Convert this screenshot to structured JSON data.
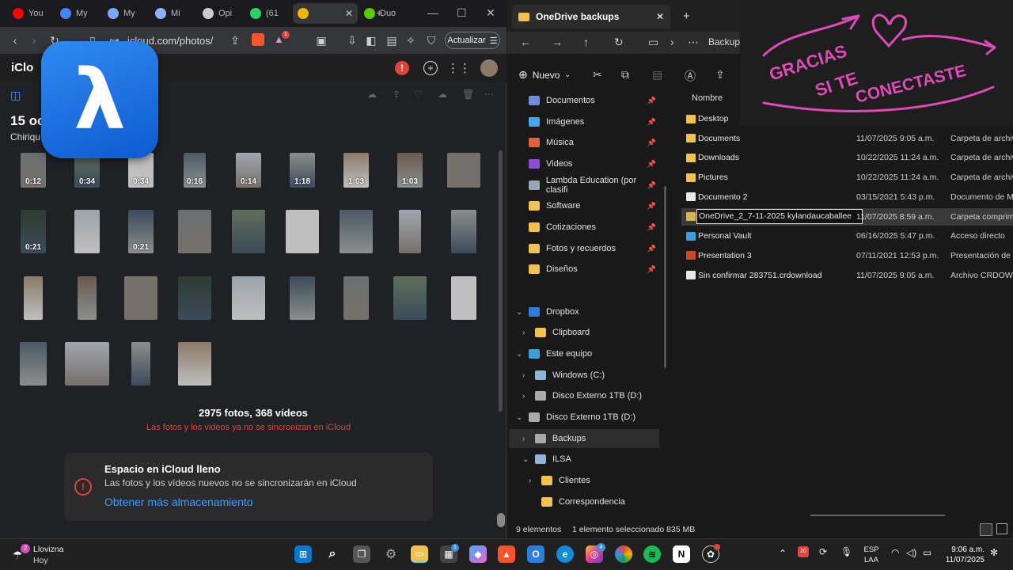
{
  "browser": {
    "tabs": [
      {
        "label": "You",
        "color": "#ff0000"
      },
      {
        "label": "My",
        "color": "#4285f4"
      },
      {
        "label": "My",
        "color": "#7aa7ff"
      },
      {
        "label": "Mi",
        "color": "#8ab4f8"
      },
      {
        "label": "Opi",
        "color": "#cccccc"
      },
      {
        "label": "(61",
        "color": "#25d366"
      },
      {
        "label": "",
        "color": "#f4b400"
      },
      {
        "label": "Duo",
        "color": "#58cc02"
      }
    ],
    "url": "icloud.com/photos/",
    "update_label": "Actualizar",
    "brave_badge": "1"
  },
  "icloud": {
    "brand": "iClo",
    "alert_badge": "!",
    "date_title": "15 oc",
    "location": "Chiriqu",
    "lambda_glyph": "λ",
    "counts": "2975 fotos, 368 vídeos",
    "sync_warning": "Las fotos y los videos ya no se sincronizan en iCloud",
    "storage_card": {
      "title": "Espacio en iCloud lleno",
      "description": "Las fotos y los vídeos nuevos no se sincronizarán en iCloud",
      "link": "Obtener más almacenamiento",
      "icon": "!"
    },
    "photos": [
      {
        "duration": "0:12"
      },
      {
        "duration": "0:34"
      },
      {
        "duration": "0:34"
      },
      {
        "duration": "0:16"
      },
      {
        "duration": "0:14"
      },
      {
        "duration": "1:18"
      },
      {
        "duration": "1:03"
      },
      {
        "duration": "1:03"
      },
      {
        "duration": ""
      },
      {
        "duration": "0:21"
      },
      {
        "duration": ""
      },
      {
        "duration": "0:21"
      },
      {
        "duration": ""
      },
      {
        "duration": ""
      },
      {
        "duration": ""
      },
      {
        "duration": ""
      },
      {
        "duration": ""
      },
      {
        "duration": ""
      },
      {
        "duration": ""
      },
      {
        "duration": ""
      },
      {
        "duration": ""
      },
      {
        "duration": ""
      },
      {
        "duration": ""
      },
      {
        "duration": ""
      },
      {
        "duration": ""
      },
      {
        "duration": ""
      },
      {
        "duration": ""
      },
      {
        "duration": ""
      },
      {
        "duration": ""
      },
      {
        "duration": ""
      },
      {
        "duration": ""
      }
    ]
  },
  "explorer": {
    "tab_title": "OneDrive backups",
    "breadcrumb": "Backups",
    "new_label": "Nuevo",
    "column_name": "Nombre",
    "sidebar": [
      {
        "label": "Documentos",
        "color": "#6e8fd8",
        "pinned": true
      },
      {
        "label": "Imágenes",
        "color": "#4aa3f0",
        "pinned": true
      },
      {
        "label": "Música",
        "color": "#e0623c",
        "pinned": true
      },
      {
        "label": "Videos",
        "color": "#8a4fd8",
        "pinned": true
      },
      {
        "label": "Lambda Education (por clasifi",
        "color": "#9aa6b8",
        "pinned": true
      },
      {
        "label": "Software",
        "color": "#f2c14e",
        "pinned": true
      },
      {
        "label": "Cotizaciones",
        "color": "#f2c14e",
        "pinned": true
      },
      {
        "label": "Fotos y recuerdos",
        "color": "#f2c14e",
        "pinned": true
      },
      {
        "label": "Diseños",
        "color": "#f2c14e",
        "pinned": true
      },
      {
        "label": "Dropbox",
        "color": "#2a7de1",
        "pinned": false
      },
      {
        "label": "Clipboard",
        "color": "#f2c14e",
        "pinned": false
      },
      {
        "label": "Este equipo",
        "color": "#3aa0d8",
        "pinned": false
      },
      {
        "label": "Windows (C:)",
        "color": "#8fb4d8",
        "pinned": false
      },
      {
        "label": "Disco Externo 1TB (D:)",
        "color": "#aaaaaa",
        "pinned": false
      },
      {
        "label": "Disco Externo 1TB (D:)",
        "color": "#aaaaaa",
        "pinned": false
      },
      {
        "label": "Backups",
        "color": "#aaaaaa",
        "pinned": false
      },
      {
        "label": "ILSA",
        "color": "#8fb4d8",
        "pinned": false
      },
      {
        "label": "Clientes",
        "color": "#f2c14e",
        "pinned": false
      },
      {
        "label": "Correspondencia",
        "color": "#f2c14e",
        "pinned": false
      }
    ],
    "files": [
      {
        "name": "Desktop",
        "date": "",
        "type": "",
        "color": "#f2c14e"
      },
      {
        "name": "Documents",
        "date": "11/07/2025 9:05 a.m.",
        "type": "Carpeta de archivos",
        "color": "#f2c14e"
      },
      {
        "name": "Downloads",
        "date": "10/22/2025 11:24 a.m.",
        "type": "Carpeta de archivos",
        "color": "#f2c14e"
      },
      {
        "name": "Pictures",
        "date": "10/22/2025 11:24 a.m.",
        "type": "Carpeta de archivos",
        "color": "#f2c14e"
      },
      {
        "name": "Documento 2",
        "date": "03/15/2021 5:43 p.m.",
        "type": "Documento de Microsoft",
        "color": "#e8e8e8"
      },
      {
        "name": "OneDrive_2_7-11-2025 kylandaucaballee",
        "date": "11/07/2025 8:59 a.m.",
        "type": "Carpeta comprimida",
        "color": "#d8b84a"
      },
      {
        "name": "Personal Vault",
        "date": "06/16/2025 5:47 p.m.",
        "type": "Acceso directo",
        "color": "#3aa0d8"
      },
      {
        "name": "Presentation 3",
        "date": "07/11/2021 12:53 p.m.",
        "type": "Presentación de Micro",
        "color": "#d24726"
      },
      {
        "name": "Sin confirmar 283751.crdownload",
        "date": "11/07/2025 9:05 a.m.",
        "type": "Archivo CRDOWNLOAD",
        "color": "#e8e8e8"
      }
    ],
    "status": {
      "items": "9 elementos",
      "selected": "1 elemento seleccionado  835 MB"
    }
  },
  "overlay": {
    "line1": "GRACIAS",
    "line2": "SI TE",
    "line3": "CONECTASTE",
    "color": "#e04ab8"
  },
  "taskbar": {
    "weather_title": "Llovizna",
    "weather_sub": "Hoy",
    "weather_badge": "2",
    "language_1": "ESP",
    "language_2": "LAA",
    "time": "9:06 a.m.",
    "date": "11/07/2025",
    "store_badge": "1",
    "instagram_badge": "4",
    "calendar_day": "20"
  }
}
